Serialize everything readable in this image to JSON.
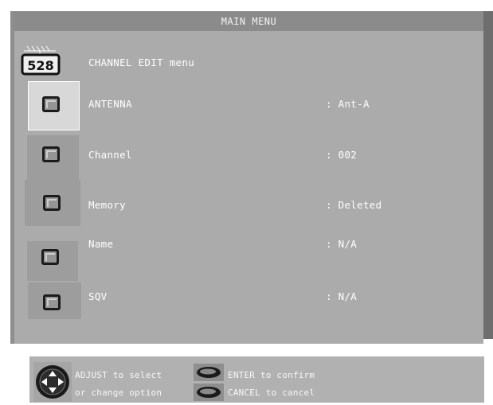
{
  "title": "MAIN MENU",
  "header": {
    "icon_text": "528",
    "label": "CHANNEL EDIT menu"
  },
  "rows": [
    {
      "label": "ANTENNA",
      "value": ": Ant-A",
      "selected": true
    },
    {
      "label": "Channel",
      "value": ": 002"
    },
    {
      "label": "Memory",
      "value": ": Deleted"
    },
    {
      "label": "Name",
      "value": ": N/A"
    },
    {
      "label": "SQV",
      "value": ": N/A"
    }
  ],
  "footer": {
    "adjust_line1": "ADJUST to select",
    "adjust_line2": "or change option",
    "enter": "ENTER to confirm",
    "cancel": "CANCEL to cancel"
  },
  "colors": {
    "panel": "#ababab",
    "titlebar": "#8b8b8b",
    "shadow": "#6e6e6e",
    "text": "#ffffff"
  },
  "icons": {
    "header": "channel-528-icon",
    "row_button": "square-button-icon",
    "joystick": "joystick-icon",
    "enter": "enter-button-icon",
    "cancel": "cancel-button-icon"
  }
}
